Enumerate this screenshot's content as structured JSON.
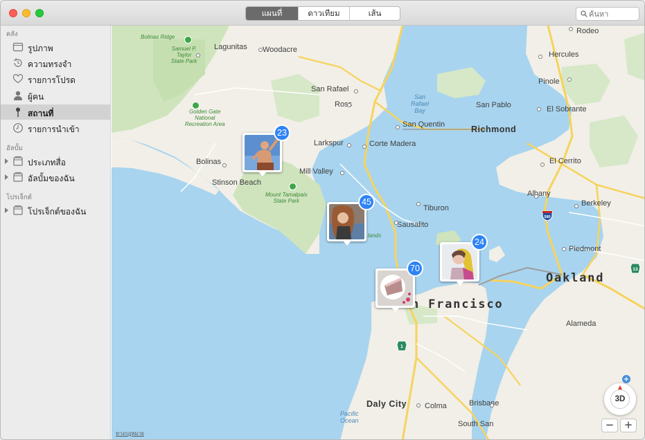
{
  "toolbar": {
    "tabs": [
      "แผนที่",
      "ดาวเทียม",
      "เส้นตาราง"
    ],
    "active_tab": "แผนที่",
    "search_placeholder": "ค้นหา"
  },
  "sidebar": {
    "sections": [
      {
        "title": "คลัง",
        "items": [
          {
            "label": "รูปภาพ",
            "icon": "photos-icon"
          },
          {
            "label": "ความทรงจำ",
            "icon": "memories-icon"
          },
          {
            "label": "รายการโปรด",
            "icon": "heart-icon"
          },
          {
            "label": "ผู้คน",
            "icon": "person-icon"
          },
          {
            "label": "สถานที่",
            "icon": "pin-icon",
            "selected": true
          },
          {
            "label": "รายการนำเข้า",
            "icon": "clock-icon"
          }
        ]
      },
      {
        "title": "อัลบั้ม",
        "items": [
          {
            "label": "ประเภทสื่อ",
            "icon": "album-icon"
          },
          {
            "label": "อัลบั้มของฉัน",
            "icon": "album-icon"
          }
        ]
      },
      {
        "title": "โปรเจ็กต์",
        "items": [
          {
            "label": "โปรเจ็กต์ของฉัน",
            "icon": "album-icon"
          }
        ]
      }
    ]
  },
  "map": {
    "labels": {
      "rodeo": "Rodeo",
      "hercules": "Hercules",
      "pinole": "Pinole",
      "san_pablo": "San Pablo",
      "el_sobrante": "El Sobrante",
      "richmond": "Richmond",
      "el_cerrito": "El Cerrito",
      "albany": "Albany",
      "berkeley": "Berkeley",
      "piedmont": "Piedmont",
      "oakland": "Oakland",
      "alameda": "Alameda",
      "san_francisco": "n Francisco",
      "daly_city": "Daly City",
      "colma": "Colma",
      "brisbane": "Brisbane",
      "south_san": "South San",
      "lagunitas": "Lagunitas",
      "woodacre": "Woodacre",
      "san_rafael": "San Rafael",
      "ross": "Ross",
      "san_quentin": "San Quentin",
      "larkspur": "Larkspur",
      "corte_madera": "Corte Madera",
      "mill_valley": "Mill Valley",
      "tiburon": "Tiburon",
      "sausalito": "Sausalito",
      "bolinas": "Bolinas",
      "stinson": "Stinson Beach",
      "bolinas_ridge": "Bolinas Ridge",
      "samuel_taylor": "Samuel P.\nTaylor\nState Park",
      "golden_gate": "Golden Gate\nNational\nRecreation Area",
      "tamalpais": "Mount Tamalpais\nState Park",
      "san_rafael_bay": "San\nRafael\nBay",
      "pacific_ocean": "Pacific\nOcean",
      "headlands": "lands"
    },
    "photo_counts": {
      "pin_bolinas": "23",
      "pin_sausalito": "45",
      "pin_sf": "70",
      "pin_oakland": "24"
    },
    "shields": {
      "i580": "580",
      "ca1": "1",
      "ca13": "13"
    },
    "compass_label": "3D",
    "zoom_out": "−",
    "zoom_in": "+",
    "legal": "ทางกฎหมาย"
  }
}
